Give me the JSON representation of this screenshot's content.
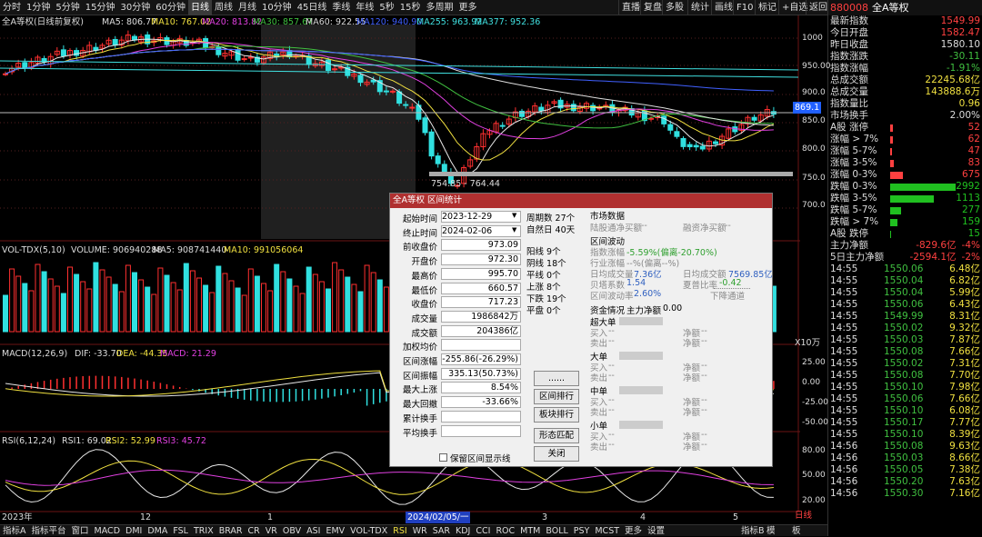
{
  "timeframes": [
    "分时",
    "1分钟",
    "5分钟",
    "15分钟",
    "30分钟",
    "60分钟",
    "日线",
    "周线",
    "月线",
    "10分钟",
    "45日线",
    "季线",
    "年线",
    "5秒",
    "15秒",
    "多周期",
    "更多"
  ],
  "top_right": [
    "直播",
    "复盘",
    "多股",
    "统计",
    "画线",
    "F10",
    "标记",
    "+自选",
    "返回"
  ],
  "main": {
    "title": "全A等权(日线前复权)",
    "ma5": "MA5: 806.77",
    "ma10": "MA10: 767.02",
    "ma20": "MA20: 813.82",
    "ma30": "MA30: 857.67",
    "ma60": "MA60: 922.55",
    "ma120": "MA120: 940.90",
    "ma255": "MA255: 963.92",
    "ma377": "MA377: 952.36",
    "axis": [
      "1000",
      "950.00",
      "900.0",
      "850.0",
      "800.0",
      "750.0",
      "700.0"
    ],
    "price_tag": "869.1",
    "range_label": "754.85 - 764.44"
  },
  "vol": {
    "title": "VOL-TDX(5,10)",
    "volume": "VOLUME: 906940288",
    "ma5": "MA5: 908741440",
    "ma10": "MA10: 991056064",
    "unit": "X10万"
  },
  "macd": {
    "title": "MACD(12,26,9)",
    "dif": "DIF: -33.70",
    "dea": "DEA: -44.35",
    "macd": "MACD: 21.29",
    "axis": [
      "25.00",
      "0.00",
      "-25.00",
      "-50.00"
    ]
  },
  "rsi": {
    "title": "RSI(6,12,24)",
    "rsi1": "RSI1: 69.02",
    "rsi2": "RSI2: 52.99",
    "rsi3": "RSI3: 45.72",
    "axis": [
      "80.00",
      "50.00",
      "20.00"
    ]
  },
  "xaxis": {
    "year": "2023年",
    "m12": "12",
    "m1": "1",
    "m2": "2",
    "m3": "3",
    "m4": "4",
    "m5": "5",
    "cursor": "2024/02/05/一",
    "period": "日线"
  },
  "bottom_tabs": [
    "指标A",
    "指标平台",
    "窗口",
    "MACD",
    "DMI",
    "DMA",
    "FSL",
    "TRIX",
    "BRAR",
    "CR",
    "VR",
    "OBV",
    "ASI",
    "EMV",
    "VOL-TDX",
    "RSI",
    "WR",
    "SAR",
    "KDJ",
    "CCI",
    "ROC",
    "MTM",
    "BOLL",
    "PSY",
    "MCST",
    "更多",
    "设置"
  ],
  "bottom_right": [
    "指标B",
    "模",
    "板"
  ],
  "dialog": {
    "title": "全A等权 区间统计",
    "fields": [
      {
        "label": "起始时间",
        "value": "2023-12-29"
      },
      {
        "label": "终止时间",
        "value": "2024-02-06"
      },
      {
        "label": "前收盘价",
        "value": "973.09"
      },
      {
        "label": "开盘价",
        "value": "972.30"
      },
      {
        "label": "最高价",
        "value": "995.70"
      },
      {
        "label": "最低价",
        "value": "660.57"
      },
      {
        "label": "收盘价",
        "value": "717.23"
      },
      {
        "label": "成交量",
        "value": "1986842万"
      },
      {
        "label": "成交额",
        "value": "204386亿"
      },
      {
        "label": "加权均价",
        "value": ""
      },
      {
        "label": "区间涨幅",
        "value": "-255.86(-26.29%)"
      },
      {
        "label": "区间振幅",
        "value": "335.13(50.73%)"
      },
      {
        "label": "最大上涨",
        "value": "8.54%"
      },
      {
        "label": "最大回撤",
        "value": "-33.66%"
      },
      {
        "label": "累计换手",
        "value": ""
      },
      {
        "label": "平均换手",
        "value": ""
      }
    ],
    "stats": [
      "周期数 27个",
      "自然日 40天",
      "阳线 9个",
      "阴线 18个",
      "平线 0个",
      "上涨 8个",
      "下跌 19个",
      "平盘 0个"
    ],
    "buttons": [
      "......",
      "区间排行",
      "板块排行",
      "形态匹配",
      "关闭"
    ],
    "checkbox": "保留区间显示线",
    "market_title": "市场数据",
    "hsgt": "陆股通净买额",
    "hsgt_v": "--",
    "rzrq": "融资净买额",
    "rzrq_v": "--",
    "fluct_title": "区间波动",
    "idx_chg": "指数涨幅",
    "idx_chg_v": "-5.59%(偏离-20.70%)",
    "ind_chg": "行业涨幅",
    "ind_chg_v": "--%(偏离--%)",
    "daily_vol": "日均成交量",
    "daily_vol_v": "7.36亿",
    "daily_amt": "日均成交额",
    "daily_amt_v": "7569.85亿",
    "beta": "贝塔系数",
    "beta_v": "1.54",
    "sharpe": "夏普比率",
    "sharpe_v": "-0.42",
    "volat": "区间波动率",
    "volat_v": "2.60%",
    "trend": "下降通道",
    "cap_title": "资金情况",
    "main_net": "主力净额",
    "main_net_v": "0.00",
    "groups": [
      {
        "name": "超大单"
      },
      {
        "name": "大单"
      },
      {
        "name": "中单"
      },
      {
        "name": "小单"
      }
    ],
    "buy": "买入",
    "sell": "卖出",
    "net": "净额",
    "dash": "--"
  },
  "right": {
    "code": "880008",
    "name": "全A等权",
    "quotes": [
      {
        "k": "最新指数",
        "v": "1549.99",
        "c": "#ff4040"
      },
      {
        "k": "今日开盘",
        "v": "1582.47",
        "c": "#ff4040"
      },
      {
        "k": "昨日收盘",
        "v": "1580.10",
        "c": "#ddd"
      },
      {
        "k": "指数涨跌",
        "v": "-30.11",
        "c": "#40c040"
      },
      {
        "k": "指数涨幅",
        "v": "-1.91%",
        "c": "#40c040"
      },
      {
        "k": "总成交额",
        "v": "22245.68亿",
        "c": "#f0e040"
      },
      {
        "k": "总成交量",
        "v": "143888.6万",
        "c": "#f0e040"
      },
      {
        "k": "指数量比",
        "v": "0.96",
        "c": "#f0e040"
      },
      {
        "k": "市场换手",
        "v": "2.00%",
        "c": "#ddd"
      }
    ],
    "updown": [
      {
        "k": "A股 涨停",
        "v": "52",
        "c": "#ff4040",
        "w": 3
      },
      {
        "k": "涨幅 > 7%",
        "v": "62",
        "c": "#ff4040",
        "w": 3
      },
      {
        "k": "涨幅 5-7%",
        "v": "47",
        "c": "#ff4040",
        "w": 2
      },
      {
        "k": "涨幅 3-5%",
        "v": "83",
        "c": "#ff4040",
        "w": 4
      },
      {
        "k": "涨幅 0-3%",
        "v": "675",
        "c": "#ff4040",
        "w": 14
      },
      {
        "k": "跌幅 0-3%",
        "v": "2992",
        "c": "#20c020",
        "w": 72
      },
      {
        "k": "跌幅 3-5%",
        "v": "1113",
        "c": "#20c020",
        "w": 48
      },
      {
        "k": "跌幅 5-7%",
        "v": "277",
        "c": "#20c020",
        "w": 12
      },
      {
        "k": "跌幅 > 7%",
        "v": "159",
        "c": "#20c020",
        "w": 8
      },
      {
        "k": "A股 跌停",
        "v": "15",
        "c": "#20c020",
        "w": 1
      }
    ],
    "flows": [
      {
        "k": "主力净额",
        "v": "-829.6亿",
        "p": "-4%"
      },
      {
        "k": "5日主力净额",
        "v": "-2594.1亿",
        "p": "-2%"
      }
    ],
    "ticks": [
      {
        "t": "14:55",
        "p": "1550.06",
        "a": "6.48亿"
      },
      {
        "t": "14:55",
        "p": "1550.04",
        "a": "6.82亿"
      },
      {
        "t": "14:55",
        "p": "1550.04",
        "a": "5.99亿"
      },
      {
        "t": "14:55",
        "p": "1550.06",
        "a": "6.43亿"
      },
      {
        "t": "14:55",
        "p": "1549.99",
        "a": "8.31亿"
      },
      {
        "t": "14:55",
        "p": "1550.02",
        "a": "9.32亿"
      },
      {
        "t": "14:55",
        "p": "1550.03",
        "a": "7.87亿"
      },
      {
        "t": "14:55",
        "p": "1550.08",
        "a": "7.66亿"
      },
      {
        "t": "14:55",
        "p": "1550.02",
        "a": "7.31亿"
      },
      {
        "t": "14:55",
        "p": "1550.08",
        "a": "7.70亿"
      },
      {
        "t": "14:55",
        "p": "1550.10",
        "a": "7.98亿"
      },
      {
        "t": "14:55",
        "p": "1550.06",
        "a": "7.66亿"
      },
      {
        "t": "14:55",
        "p": "1550.10",
        "a": "6.08亿"
      },
      {
        "t": "14:55",
        "p": "1550.17",
        "a": "7.77亿"
      },
      {
        "t": "14:55",
        "p": "1550.10",
        "a": "8.39亿"
      },
      {
        "t": "14:56",
        "p": "1550.08",
        "a": "9.63亿"
      },
      {
        "t": "14:56",
        "p": "1550.03",
        "a": "8.66亿"
      },
      {
        "t": "14:56",
        "p": "1550.05",
        "a": "7.38亿"
      },
      {
        "t": "14:56",
        "p": "1550.20",
        "a": "7.63亿"
      },
      {
        "t": "14:56",
        "p": "1550.30",
        "a": "7.16亿"
      }
    ]
  }
}
